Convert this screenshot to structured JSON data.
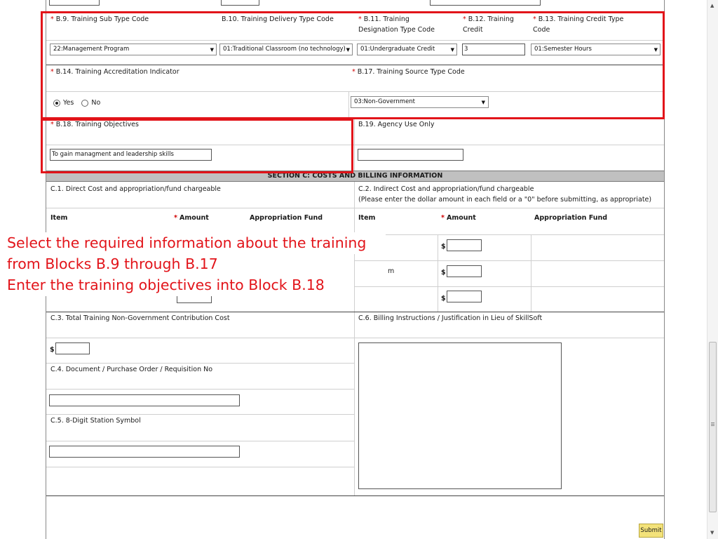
{
  "section_b": {
    "b9": {
      "label": "B.9. Training Sub Type Code",
      "value": "22:Management Program"
    },
    "b10": {
      "label": "B.10. Training Delivery Type Code",
      "value": "01:Traditional Classroom (no technology)"
    },
    "b11": {
      "label_line1": "B.11. Training",
      "label_line2": "Designation Type Code",
      "value": "01:Undergraduate Credit"
    },
    "b12": {
      "label_line1": "B.12.  Training",
      "label_line2": "Credit",
      "value": "3"
    },
    "b13": {
      "label_line1": "B.13. Training Credit Type",
      "label_line2": "Code",
      "value": "01:Semester Hours"
    },
    "b14": {
      "label": "B.14.  Training Accreditation Indicator",
      "yes_label": "Yes",
      "no_label": "No",
      "selected": "Yes"
    },
    "b17": {
      "label": "B.17. Training Source Type Code",
      "value": "03:Non-Government"
    },
    "b18": {
      "label": "B.18. Training Objectives",
      "value": "To gain managment and leadership skills"
    },
    "b19": {
      "label": "B.19. Agency Use Only",
      "value": ""
    }
  },
  "required_marker": "*",
  "section_c": {
    "header": "SECTION C: COSTS AND BILLING INFORMATION",
    "c1": {
      "label": "C.1. Direct Cost and appropriation/fund chargeable",
      "columns": {
        "item": "Item",
        "amount": "Amount",
        "fund": "Appropriation Fund"
      }
    },
    "c2": {
      "label_line1": "C.2. Indirect Cost and appropriation/fund chargeable",
      "label_line2": "(Please enter the dollar amount in each field or a \"0\" before submitting, as appropriate)",
      "columns": {
        "item": "Item",
        "amount": "Amount",
        "fund": "Appropriation Fund"
      },
      "partial_item": "m"
    },
    "c3": {
      "label": "C.3.  Total Training Non-Government Contribution Cost"
    },
    "c4": {
      "label": "C.4. Document / Purchase Order / Requisition No"
    },
    "c5": {
      "label": "C.5. 8-Digit Station Symbol"
    },
    "c6": {
      "label": "C.6. Billing Instructions / Justification in Lieu of SkillSoft"
    },
    "currency": "$"
  },
  "callout": {
    "line1": "Select the required information about the training",
    "line2": "from Blocks B.9 through B.17",
    "line3": "Enter the training objectives into Block B.18"
  },
  "submit_label": "Submit",
  "colors": {
    "highlight": "#e2141a",
    "section_header_bg": "#c0c0c0",
    "submit_bg": "#f3e27a"
  }
}
